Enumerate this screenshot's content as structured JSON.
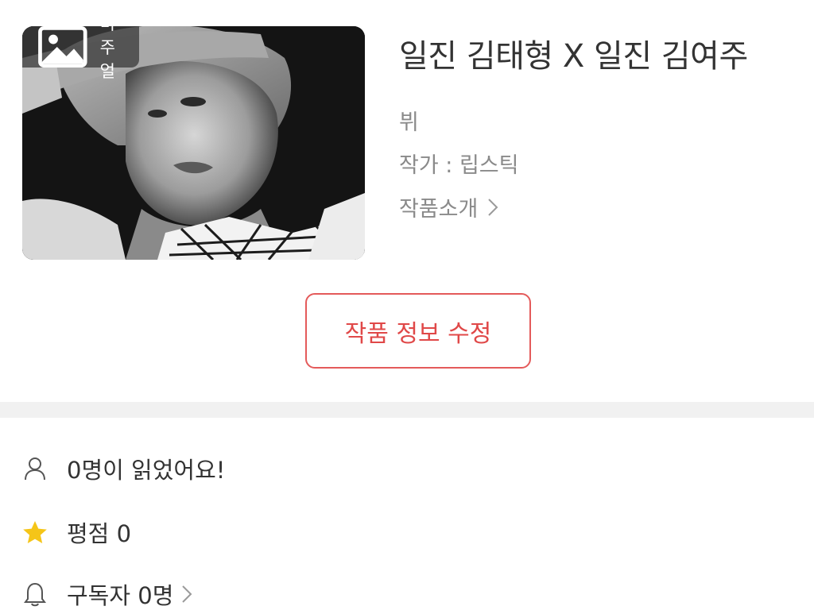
{
  "work": {
    "cover_badge": "비주얼",
    "title": "일진 김태형 X 일진 김여주",
    "genre": "뷔",
    "author": "작가 : 립스틱",
    "intro_link": "작품소개"
  },
  "actions": {
    "edit_label": "작품 정보 수정"
  },
  "stats": {
    "readers": "0명이 읽었어요!",
    "rating": "평점 0",
    "subscribers": "구독자 0명"
  },
  "icons": {
    "badge": "image-icon",
    "intro": "chevron-right-icon",
    "readers": "person-icon",
    "rating": "star-icon",
    "subscribers": "bell-icon"
  },
  "colors": {
    "accent": "#e04848",
    "star": "#f5c518",
    "muted_text": "#8a8a8a",
    "divider": "#f1f1f1"
  }
}
